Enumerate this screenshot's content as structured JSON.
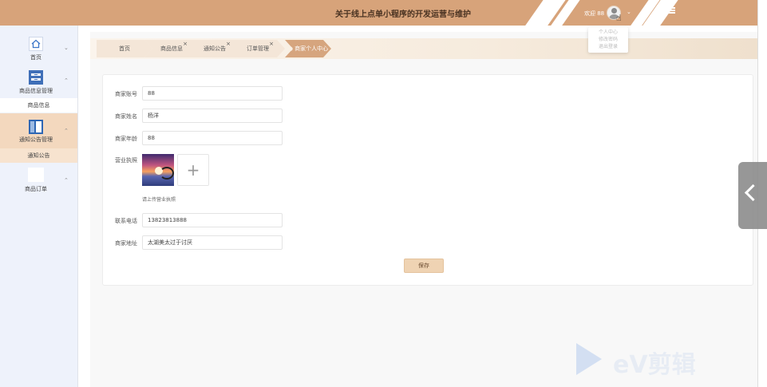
{
  "header": {
    "title": "关于线上点单小程序的开发运营与维护",
    "welcome": "欢迎 88",
    "user_menu": [
      "个人中心",
      "修改密码",
      "退出登录"
    ]
  },
  "sidebar": {
    "groups": [
      {
        "label": "首页",
        "icon": "home-icon"
      },
      {
        "label": "商品信息管理",
        "icon": "goods-icon",
        "sub": "商品信息"
      },
      {
        "label": "通知公告管理",
        "icon": "notice-icon",
        "sub": "通知公告"
      },
      {
        "label": "商品订单",
        "icon": "order-icon"
      }
    ]
  },
  "tabs": [
    {
      "label": "首页"
    },
    {
      "label": "商品信息"
    },
    {
      "label": "通知公告"
    },
    {
      "label": "订单管理"
    },
    {
      "label": "● 商家个人中心"
    }
  ],
  "form": {
    "account_label": "商家账号",
    "account_value": "88",
    "name_label": "商家姓名",
    "name_value": "杨洋",
    "age_label": "商家年龄",
    "age_value": "88",
    "license_label": "营业执照",
    "license_hint": "请上传营业执照",
    "phone_label": "联系电话",
    "phone_value": "13823813888",
    "address_label": "商家地址",
    "address_value": "太湖美太过于讨厌",
    "save_label": "保存"
  },
  "watermark": "eV剪辑",
  "colors": {
    "header": "#d7a37a",
    "sidebar": "#eef2fb",
    "active_tab": "#d6a57e",
    "save_button": "#efd3b3"
  }
}
